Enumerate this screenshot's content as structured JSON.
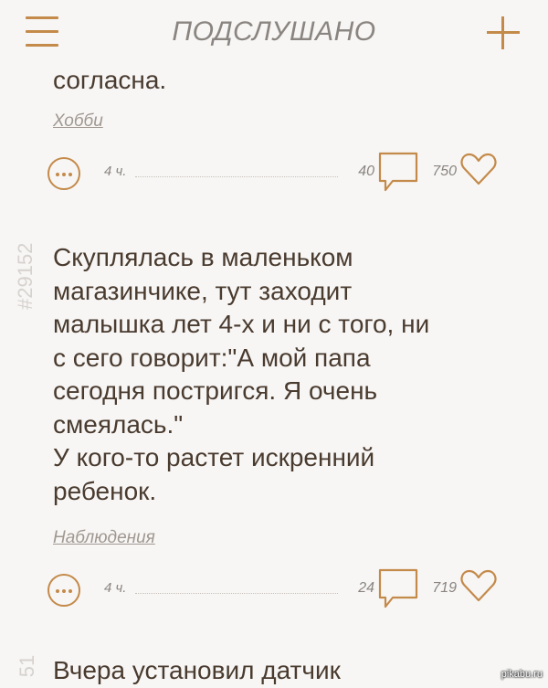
{
  "header": {
    "title": "ПОДСЛУШАНО"
  },
  "posts": [
    {
      "text_tail": "согласна.",
      "tag": "Хобби",
      "time": "4 ч.",
      "comments": "40",
      "likes": "750"
    },
    {
      "number": "#29152",
      "lines": [
        "Скуплялась в маленьком",
        "магазинчике, тут заходит",
        "малышка лет 4-х и ни с того, ни",
        "с сего говорит:\"А мой папа",
        "сегодня постригся. Я очень",
        "смеялась.\"",
        "У кого-то растет искренний",
        "ребенок."
      ],
      "tag": "Наблюдения",
      "time": "4 ч.",
      "comments": "24",
      "likes": "719"
    },
    {
      "number_partial": "51",
      "text_head": "Вчера установил датчик"
    }
  ],
  "watermark": "pikabu.ru",
  "colors": {
    "accent": "#c48a4a",
    "text": "#4a3b2f",
    "muted": "#8a8580",
    "background": "#f7f6f5"
  }
}
